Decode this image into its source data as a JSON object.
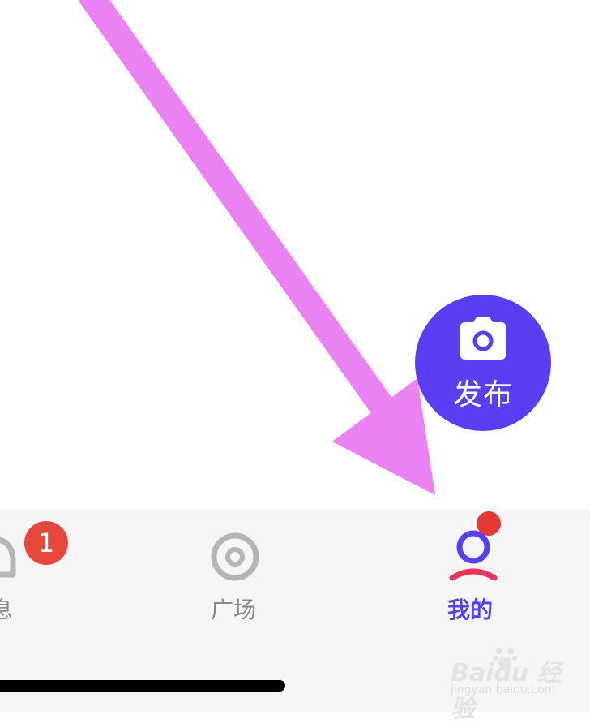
{
  "fab": {
    "label": "发布",
    "icon": "camera-icon",
    "color": "#5a3ff2"
  },
  "tabbar": {
    "background": "#f5f5f5",
    "tabs": [
      {
        "label": "息",
        "icon": "chat-bubble-icon",
        "badge": "1",
        "active": false
      },
      {
        "label": "广场",
        "icon": "target-icon",
        "active": false
      },
      {
        "label": "我的",
        "icon": "user-icon",
        "active": true,
        "dot": true
      }
    ]
  },
  "colors": {
    "accent": "#5a3ff2",
    "badge": "#e8483c",
    "inactive": "#888888",
    "arrow": "#ea82f3"
  },
  "watermark": {
    "brand": "Baidu 经验",
    "url": "jingyan.baidu.com"
  }
}
